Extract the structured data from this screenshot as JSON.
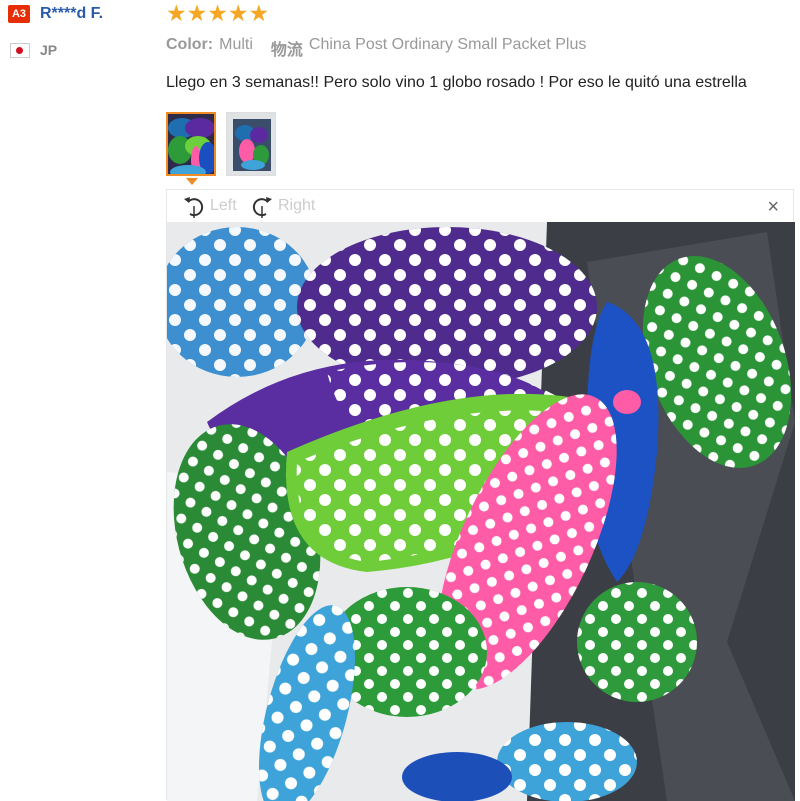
{
  "reviewer": {
    "badge": "A3",
    "name": "R****d F.",
    "country_code": "JP",
    "flag": "japan-flag-icon"
  },
  "rating": {
    "stars": 5,
    "max": 5,
    "color": "#f5a623"
  },
  "meta": {
    "color_label": "Color:",
    "color_value": "Multi",
    "shipping_label": "物流",
    "shipping_value": "China Post Ordinary Small Packet Plus"
  },
  "review": {
    "text": "Llego en 3 semanas!! Pero solo vino 1 globo rosado ! Por eso le quitó una estrella"
  },
  "thumbnails": [
    {
      "name": "balloons-thumbnail-1",
      "selected": true
    },
    {
      "name": "balloons-thumbnail-2",
      "selected": false
    }
  ],
  "viewer": {
    "rotate_left_label": "Left",
    "rotate_right_label": "Right",
    "close_glyph": "×",
    "photo": "polka-dot-balloons-photo"
  },
  "colors": {
    "accent": "#e62e04",
    "link": "#2a5caa",
    "thumb_selected": "#f08a24"
  }
}
